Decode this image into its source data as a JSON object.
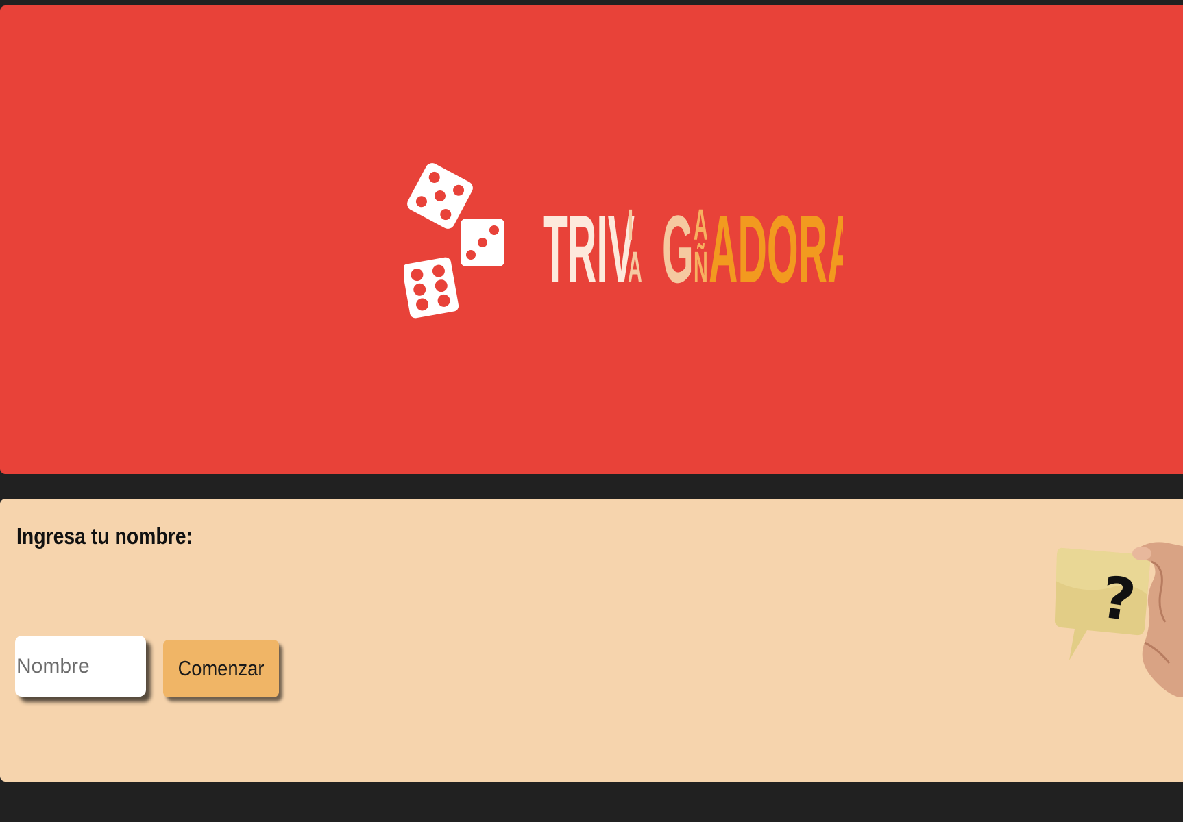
{
  "banner": {
    "logo_text_part1": "TRIV",
    "logo_text_stacked": [
      "I",
      "A"
    ],
    "logo_text_part2": "G",
    "logo_text_stacked2": [
      "A",
      "Ñ"
    ],
    "logo_text_part3": "ADORA",
    "dice_icon": "three-dice-icon",
    "colors": {
      "background": "#e84239",
      "dice": "#ffffff",
      "pips": "#e84239",
      "text_light": "#fde9dc",
      "text_peach": "#f5c9a0",
      "text_orange": "#f29a1f"
    }
  },
  "form": {
    "prompt_label": "Ingresa tu nombre:",
    "name_placeholder": "Nombre",
    "name_value": "",
    "start_label": "Comenzar",
    "illustration_icon": "question-speech-bubble-hand-icon",
    "colors": {
      "background": "#f6d4ad",
      "button": "#f0b566"
    }
  },
  "page": {
    "background": "#212121"
  }
}
